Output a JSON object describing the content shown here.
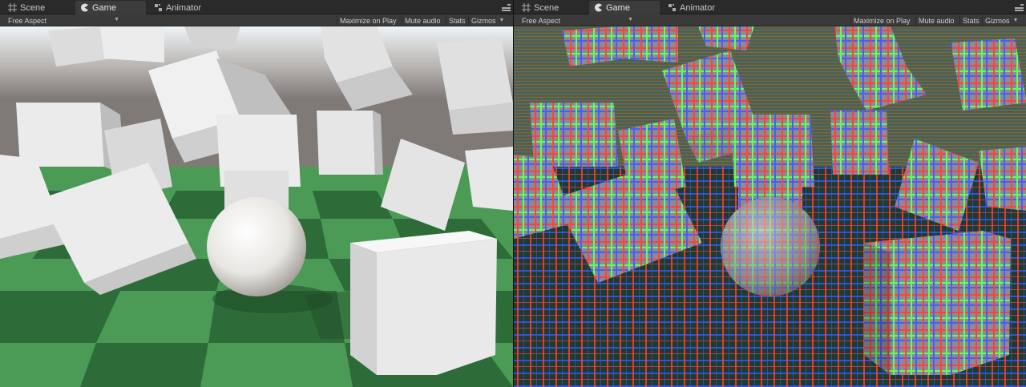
{
  "panels": [
    {
      "tabs": [
        {
          "label": "Scene",
          "icon": "scene-grid-icon"
        },
        {
          "label": "Game",
          "icon": "game-pacman-icon",
          "active": true
        },
        {
          "label": "Animator",
          "icon": "animator-icon"
        }
      ],
      "aspect": "Free Aspect",
      "toolbar": {
        "maximize": "Maximize on Play",
        "mute": "Mute audio",
        "stats": "Stats",
        "gizmos": "Gizmos"
      },
      "render_style": "plain"
    },
    {
      "tabs": [
        {
          "label": "Scene",
          "icon": "scene-grid-icon"
        },
        {
          "label": "Game",
          "icon": "game-pacman-icon",
          "active": true
        },
        {
          "label": "Animator",
          "icon": "animator-icon"
        }
      ],
      "aspect": "Free Aspect",
      "toolbar": {
        "maximize": "Maximize on Play",
        "mute": "Mute audio",
        "stats": "Stats",
        "gizmos": "Gizmos"
      },
      "render_style": "rgb-grid-overlay"
    }
  ],
  "colors": {
    "sky_top": "#e9eef2",
    "horizon": "#857f7c",
    "floor_light": "#4a9a56",
    "floor_dark": "#2c6a37",
    "cube": "#e8e8e8",
    "grid_red": "#ff3b3b",
    "grid_green": "#58ff58",
    "grid_blue": "#4a5cff"
  }
}
